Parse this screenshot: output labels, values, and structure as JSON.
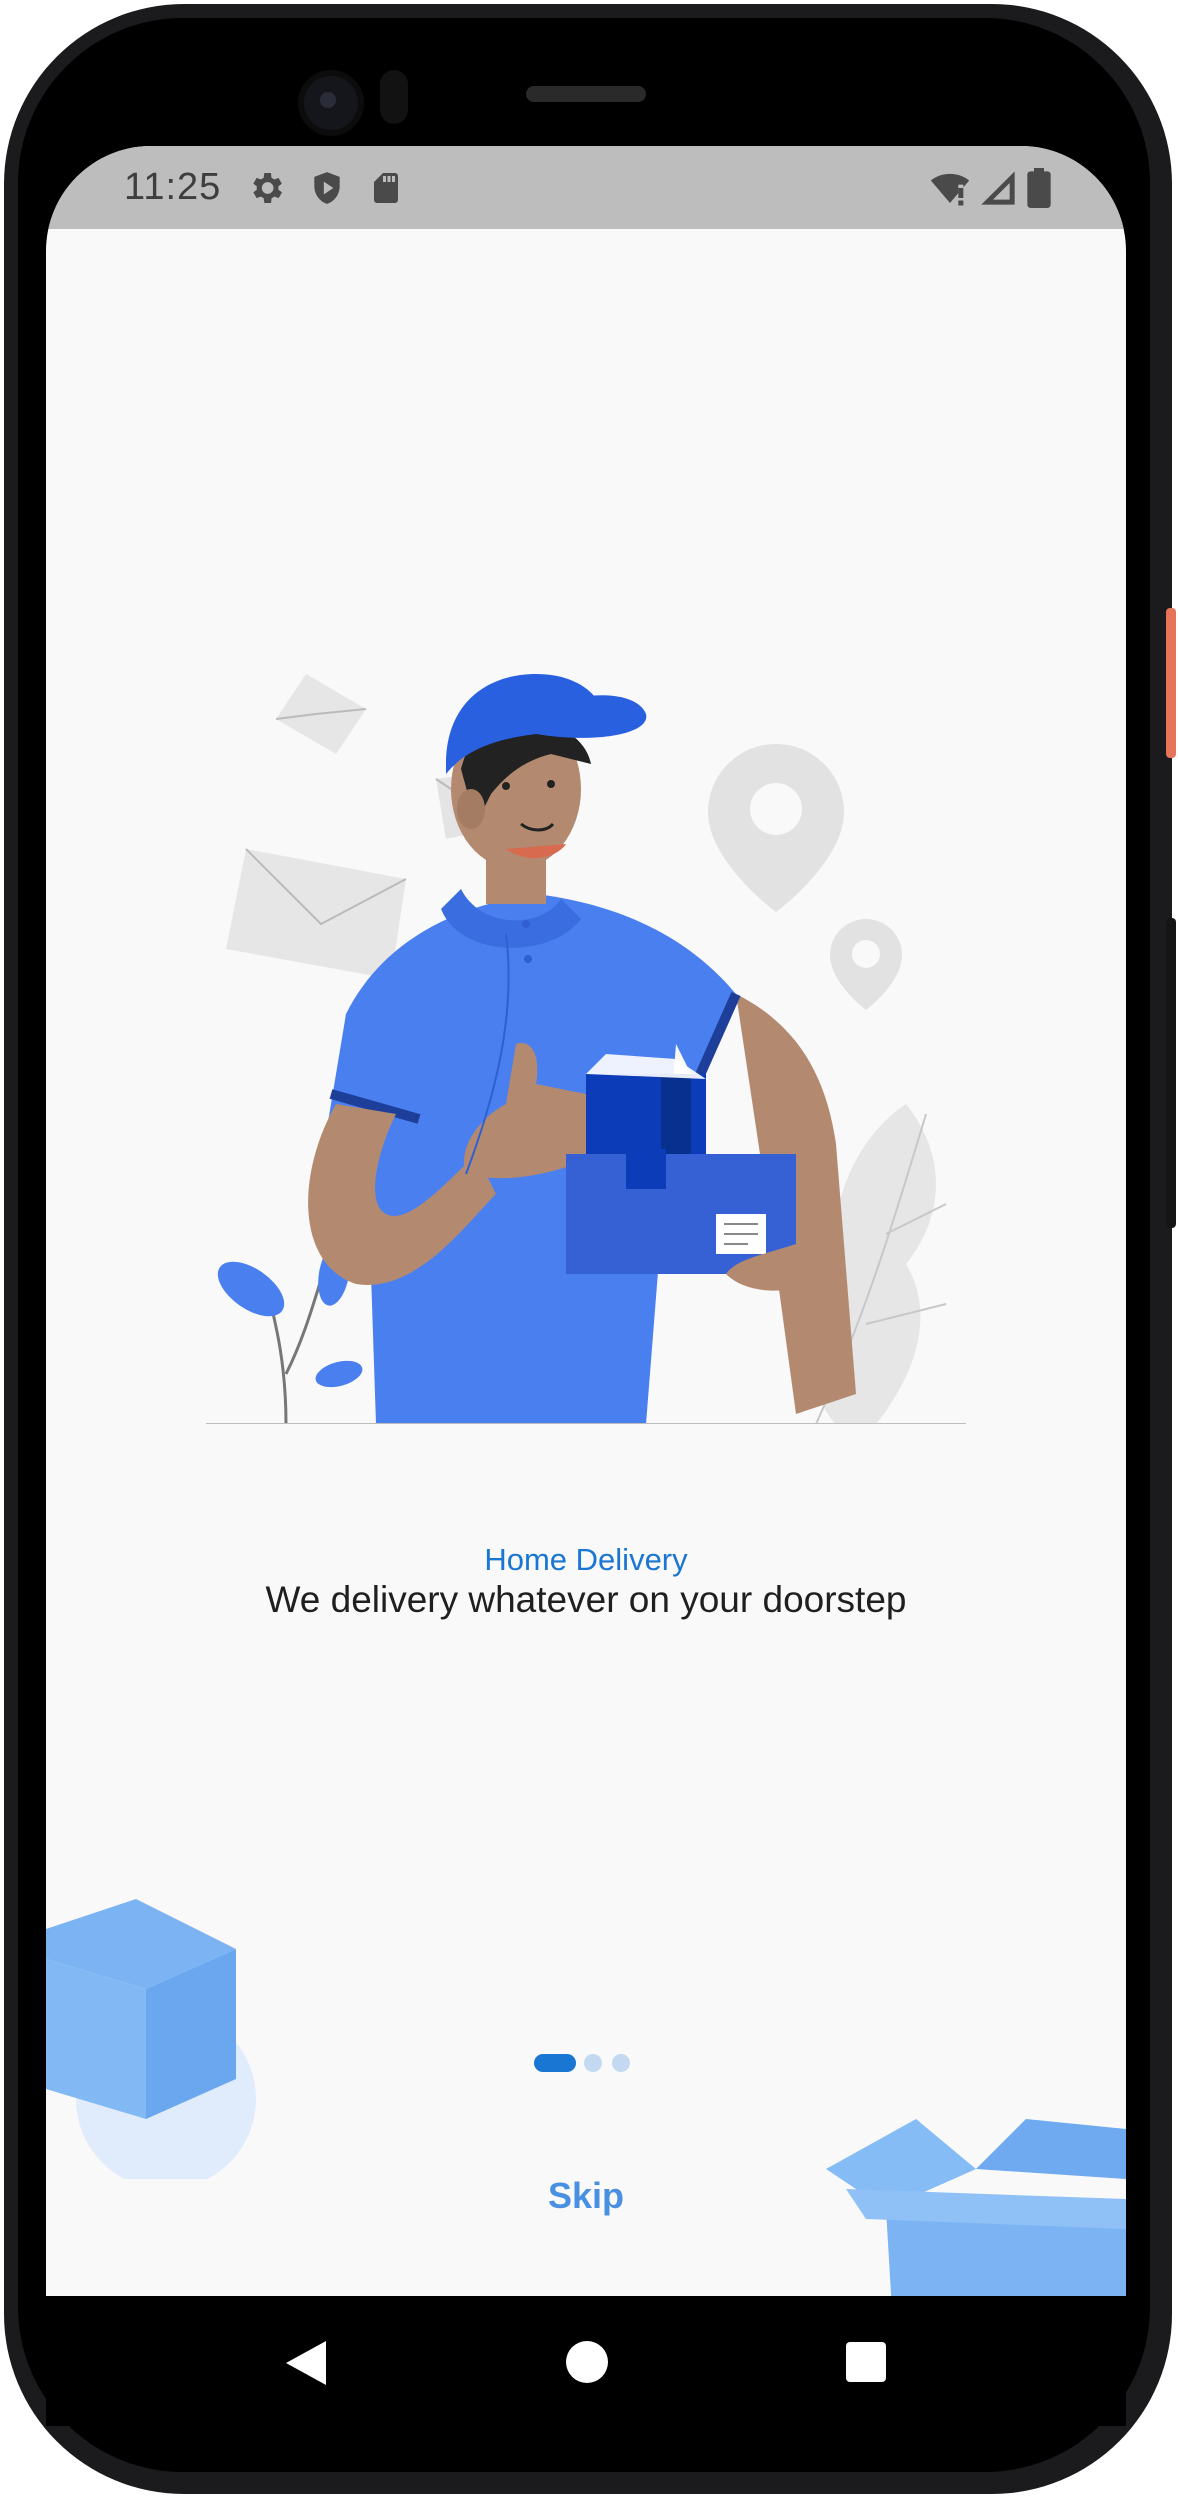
{
  "status_bar": {
    "time": "11:25",
    "left_icons": [
      "gear-icon",
      "shield-icon",
      "sd-card-icon"
    ],
    "right_icons": [
      "wifi-alert-icon",
      "cell-signal-icon",
      "battery-icon"
    ]
  },
  "onboarding": {
    "illustration": "delivery-man-illustration",
    "title": "Home Delivery",
    "subtitle": "We delivery whatever on your doorstep",
    "page_indicator": {
      "current_page": 1,
      "total_pages": 3
    },
    "skip_label": "Skip"
  },
  "nav_bar": {
    "icons": [
      "back-icon",
      "home-icon",
      "recents-icon"
    ]
  },
  "colors": {
    "accent": "#1976d2",
    "skip": "#4a90e2",
    "indicator_inactive": "#c2d9f1",
    "status_bar": "#bdbdbd",
    "screen_bg": "#f9f9f9",
    "illustration_blue": "#4a7ff0"
  }
}
